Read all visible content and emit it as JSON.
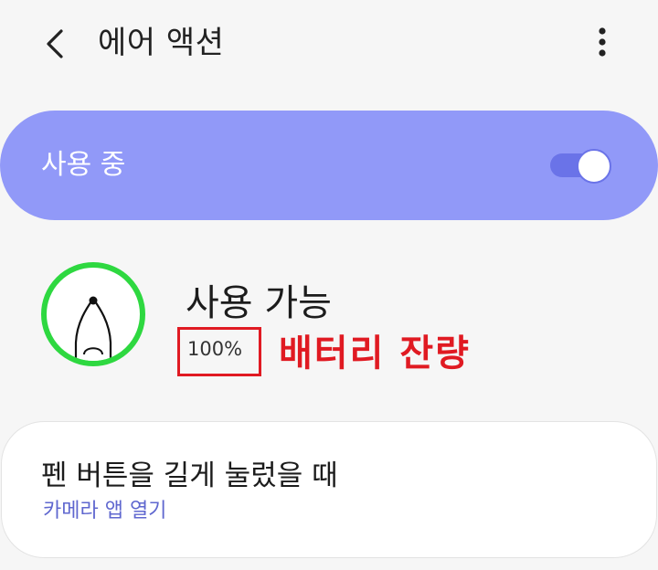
{
  "appbar": {
    "title": "에어 액션",
    "back_icon": "chevron-left-icon",
    "more_icon": "more-vertical-icon"
  },
  "master_switch": {
    "label": "사용 중",
    "enabled": true
  },
  "pen": {
    "icon": "s-pen-icon",
    "status": "사용 가능",
    "battery": "100%",
    "annotation": "배터리 잔량"
  },
  "long_press": {
    "title": "펜 버튼을 길게 눌렀을 때",
    "action": "카메라 앱 열기"
  },
  "colors": {
    "accent_card": "#9199f8",
    "toggle": "#6a73e8",
    "ring": "#2ed840",
    "annotation_red": "#e01a22",
    "link_text": "#5f67cf"
  }
}
